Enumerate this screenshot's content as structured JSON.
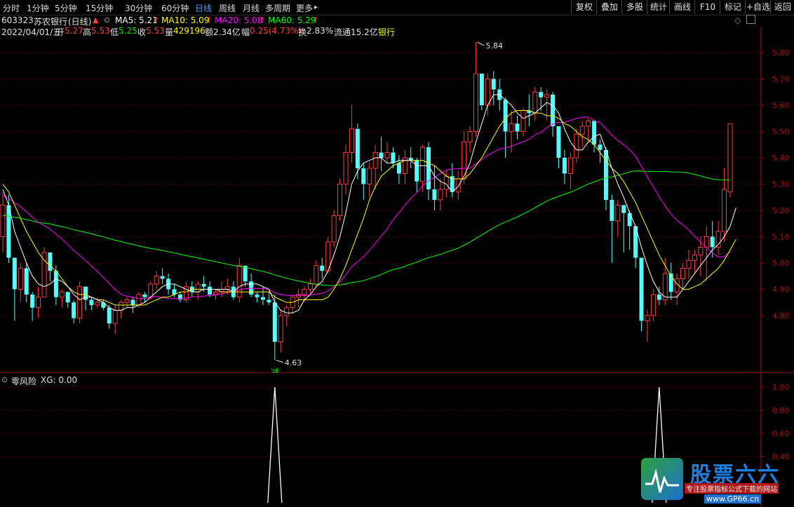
{
  "toolbar": {
    "periods": [
      "分时",
      "1分钟",
      "5分钟",
      "15分钟",
      "30分钟",
      "60分钟",
      "日线",
      "周线",
      "月线",
      "多周期",
      "更多"
    ],
    "active_period": "日线",
    "more_arrow": "▸",
    "buttons": [
      "复权",
      "叠加",
      "多股",
      "统计",
      "画线",
      "F10",
      "标记",
      "+自选",
      "返回"
    ]
  },
  "stock": {
    "code": "603323",
    "name": "苏农银行",
    "period_label": "(日线)",
    "ma5_label": "MA5: 5.21",
    "ma10_label": "MA10: 5.09",
    "ma20_label": "MA20: 5.08",
    "ma60_label": "MA60: 5.29",
    "up_arrow": "↑",
    "date": "2022/04/01/五",
    "open_label": "开",
    "open": "5.27",
    "high_label": "高",
    "high": "5.53",
    "low_label": "低",
    "low": "5.25",
    "close_label": "收",
    "close": "5.53",
    "volume_label": "量",
    "volume": "429196",
    "amount_label": "额",
    "amount": "2.34亿",
    "change_label": "幅",
    "change": "0.25(4.73%)",
    "turnover_label": "换",
    "turnover": "2.83%",
    "float_label": "流通",
    "float": "15.2亿",
    "industry": "银行"
  },
  "annotations": {
    "max_label": "5.84",
    "min_label": "4.63",
    "reduce_marker": "减"
  },
  "indicator": {
    "name": "零风险",
    "xg_label": "XG: 0.00"
  },
  "logo": {
    "title": "股票六六",
    "subtitle": "专注股票指标公式下载的网站",
    "url": "www.GP66.cn"
  },
  "colors": {
    "up": "#ff3c3c",
    "down": "#54fcfc",
    "ma5": "#ffffff",
    "ma10": "#ffff00",
    "ma20": "#ff00ff",
    "ma60": "#00ff00",
    "axis": "#b01010",
    "grid": "#5a0000"
  },
  "chart_data": [
    {
      "type": "candlestick",
      "ylim": [
        4.6,
        5.9
      ],
      "y_ticks": [
        "5.80",
        "5.70",
        "5.60",
        "5.50",
        "5.40",
        "5.30",
        "5.20",
        "5.10",
        "5.00",
        "4.90",
        "4.80"
      ],
      "series_ohlc": [
        [
          5.1,
          5.27,
          5.04,
          5.22
        ],
        [
          5.22,
          5.26,
          5.0,
          5.02
        ],
        [
          5.02,
          4.96,
          4.78,
          4.9
        ],
        [
          4.9,
          5.0,
          4.85,
          4.98
        ],
        [
          4.98,
          5.0,
          4.85,
          4.88
        ],
        [
          4.88,
          4.89,
          4.78,
          4.83
        ],
        [
          4.83,
          4.91,
          4.79,
          4.87
        ],
        [
          4.87,
          5.06,
          4.87,
          5.04
        ],
        [
          5.04,
          5.02,
          4.93,
          4.97
        ],
        [
          4.97,
          4.99,
          4.84,
          4.87
        ],
        [
          4.87,
          4.9,
          4.83,
          4.89
        ],
        [
          4.89,
          4.88,
          4.83,
          4.85
        ],
        [
          4.85,
          4.86,
          4.77,
          4.79
        ],
        [
          4.79,
          4.93,
          4.77,
          4.91
        ],
        [
          4.91,
          4.91,
          4.82,
          4.86
        ],
        [
          4.86,
          4.87,
          4.82,
          4.84
        ],
        [
          4.84,
          4.87,
          4.83,
          4.85
        ],
        [
          4.85,
          4.86,
          4.82,
          4.83
        ],
        [
          4.83,
          4.84,
          4.75,
          4.77
        ],
        [
          4.77,
          4.84,
          4.73,
          4.82
        ],
        [
          4.82,
          4.86,
          4.79,
          4.85
        ],
        [
          4.85,
          4.87,
          4.83,
          4.86
        ],
        [
          4.86,
          4.87,
          4.81,
          4.84
        ],
        [
          4.84,
          4.89,
          4.83,
          4.88
        ],
        [
          4.88,
          4.89,
          4.85,
          4.87
        ],
        [
          4.87,
          4.93,
          4.86,
          4.92
        ],
        [
          4.92,
          4.97,
          4.9,
          4.95
        ],
        [
          4.95,
          4.98,
          4.92,
          4.94
        ],
        [
          4.94,
          4.96,
          4.88,
          4.9
        ],
        [
          4.9,
          4.92,
          4.87,
          4.88
        ],
        [
          4.88,
          4.89,
          4.85,
          4.86
        ],
        [
          4.86,
          4.93,
          4.85,
          4.91
        ],
        [
          4.91,
          4.93,
          4.87,
          4.89
        ],
        [
          4.89,
          4.93,
          4.86,
          4.92
        ],
        [
          4.92,
          4.95,
          4.89,
          4.91
        ],
        [
          4.91,
          4.93,
          4.87,
          4.88
        ],
        [
          4.88,
          4.9,
          4.86,
          4.89
        ],
        [
          4.89,
          4.93,
          4.87,
          4.9
        ],
        [
          4.9,
          4.94,
          4.88,
          4.91
        ],
        [
          4.91,
          4.93,
          4.86,
          4.87
        ],
        [
          4.87,
          5.02,
          4.85,
          4.99
        ],
        [
          4.99,
          4.98,
          4.91,
          4.93
        ],
        [
          4.93,
          4.96,
          4.87,
          4.88
        ],
        [
          4.88,
          4.89,
          4.85,
          4.87
        ],
        [
          4.87,
          4.91,
          4.84,
          4.86
        ],
        [
          4.86,
          4.89,
          4.84,
          4.85
        ],
        [
          4.85,
          4.88,
          4.63,
          4.7
        ],
        [
          4.7,
          4.82,
          4.66,
          4.8
        ],
        [
          4.8,
          4.84,
          4.76,
          4.83
        ],
        [
          4.83,
          4.88,
          4.81,
          4.87
        ],
        [
          4.87,
          4.9,
          4.83,
          4.88
        ],
        [
          4.88,
          4.91,
          4.85,
          4.9
        ],
        [
          4.9,
          4.94,
          4.88,
          4.92
        ],
        [
          4.92,
          5.01,
          4.91,
          4.99
        ],
        [
          4.99,
          5.02,
          4.94,
          4.97
        ],
        [
          4.97,
          5.1,
          4.96,
          5.08
        ],
        [
          5.08,
          5.2,
          5.06,
          5.18
        ],
        [
          5.18,
          5.32,
          5.16,
          5.3
        ],
        [
          5.3,
          5.45,
          5.26,
          5.42
        ],
        [
          5.42,
          5.6,
          5.38,
          5.51
        ],
        [
          5.51,
          5.53,
          5.32,
          5.36
        ],
        [
          5.36,
          5.38,
          5.24,
          5.3
        ],
        [
          5.3,
          5.38,
          5.25,
          5.36
        ],
        [
          5.36,
          5.45,
          5.28,
          5.42
        ],
        [
          5.42,
          5.48,
          5.35,
          5.4
        ],
        [
          5.4,
          5.46,
          5.38,
          5.42
        ],
        [
          5.42,
          5.44,
          5.36,
          5.38
        ],
        [
          5.38,
          5.41,
          5.3,
          5.34
        ],
        [
          5.34,
          5.43,
          5.3,
          5.4
        ],
        [
          5.4,
          5.44,
          5.36,
          5.39
        ],
        [
          5.39,
          5.4,
          5.27,
          5.31
        ],
        [
          5.31,
          5.45,
          5.27,
          5.44
        ],
        [
          5.44,
          5.46,
          5.24,
          5.28
        ],
        [
          5.28,
          5.37,
          5.2,
          5.24
        ],
        [
          5.24,
          5.32,
          5.2,
          5.28
        ],
        [
          5.28,
          5.35,
          5.25,
          5.33
        ],
        [
          5.33,
          5.38,
          5.25,
          5.27
        ],
        [
          5.27,
          5.35,
          5.24,
          5.32
        ],
        [
          5.32,
          5.5,
          5.3,
          5.46
        ],
        [
          5.46,
          5.52,
          5.42,
          5.5
        ],
        [
          5.5,
          5.84,
          5.48,
          5.72
        ],
        [
          5.72,
          5.7,
          5.58,
          5.6
        ],
        [
          5.6,
          5.72,
          5.56,
          5.7
        ],
        [
          5.7,
          5.73,
          5.6,
          5.66
        ],
        [
          5.66,
          5.7,
          5.58,
          5.62
        ],
        [
          5.62,
          5.63,
          5.4,
          5.5
        ],
        [
          5.5,
          5.58,
          5.42,
          5.53
        ],
        [
          5.53,
          5.56,
          5.47,
          5.5
        ],
        [
          5.5,
          5.59,
          5.48,
          5.58
        ],
        [
          5.58,
          5.64,
          5.52,
          5.57
        ],
        [
          5.57,
          5.67,
          5.54,
          5.65
        ],
        [
          5.65,
          5.67,
          5.58,
          5.63
        ],
        [
          5.63,
          5.66,
          5.54,
          5.64
        ],
        [
          5.64,
          5.65,
          5.48,
          5.52
        ],
        [
          5.52,
          5.5,
          5.36,
          5.4
        ],
        [
          5.4,
          5.43,
          5.3,
          5.34
        ],
        [
          5.34,
          5.42,
          5.28,
          5.4
        ],
        [
          5.4,
          5.51,
          5.38,
          5.49
        ],
        [
          5.49,
          5.54,
          5.44,
          5.52
        ],
        [
          5.52,
          5.55,
          5.46,
          5.54
        ],
        [
          5.54,
          5.53,
          5.42,
          5.45
        ],
        [
          5.45,
          5.47,
          5.38,
          5.43
        ],
        [
          5.43,
          5.44,
          5.2,
          5.24
        ],
        [
          5.24,
          5.26,
          5.0,
          5.16
        ],
        [
          5.16,
          5.24,
          5.1,
          5.22
        ],
        [
          5.22,
          5.21,
          5.04,
          5.19
        ],
        [
          5.19,
          5.2,
          5.05,
          5.14
        ],
        [
          5.14,
          5.12,
          4.98,
          5.02
        ],
        [
          5.02,
          5.0,
          4.74,
          4.78
        ],
        [
          4.78,
          4.82,
          4.7,
          4.8
        ],
        [
          4.8,
          4.9,
          4.78,
          4.88
        ],
        [
          4.88,
          4.91,
          4.84,
          4.86
        ],
        [
          4.86,
          5.02,
          4.84,
          4.96
        ],
        [
          4.96,
          5.0,
          4.86,
          4.89
        ],
        [
          4.89,
          4.96,
          4.84,
          4.94
        ],
        [
          4.94,
          5.0,
          4.9,
          4.98
        ],
        [
          4.98,
          5.05,
          4.94,
          5.01
        ],
        [
          5.01,
          5.05,
          4.96,
          5.03
        ],
        [
          5.03,
          5.1,
          4.95,
          5.06
        ],
        [
          5.06,
          5.14,
          4.93,
          5.1
        ],
        [
          5.1,
          5.16,
          5.02,
          5.06
        ],
        [
          5.06,
          5.16,
          5.03,
          5.12
        ],
        [
          5.12,
          5.36,
          5.08,
          5.28
        ],
        [
          5.27,
          5.53,
          5.25,
          5.53
        ]
      ],
      "ma5": [
        5.28,
        5.22,
        5.12,
        5.06,
        5.0,
        4.95,
        4.92,
        4.91,
        4.92,
        4.94,
        4.93,
        4.91,
        4.88,
        4.86,
        4.87,
        4.87,
        4.86,
        4.85,
        4.83,
        4.82,
        4.82,
        4.83,
        4.83,
        4.84,
        4.85,
        4.87,
        4.89,
        4.91,
        4.92,
        4.92,
        4.91,
        4.9,
        4.89,
        4.89,
        4.9,
        4.9,
        4.9,
        4.9,
        4.9,
        4.89,
        4.91,
        4.92,
        4.92,
        4.92,
        4.91,
        4.9,
        4.85,
        4.82,
        4.81,
        4.81,
        4.82,
        4.86,
        4.88,
        4.91,
        4.93,
        4.97,
        5.03,
        5.1,
        5.19,
        5.3,
        5.35,
        5.38,
        5.39,
        5.4,
        5.4,
        5.38,
        5.38,
        5.39,
        5.39,
        5.39,
        5.37,
        5.37,
        5.37,
        5.33,
        5.31,
        5.3,
        5.27,
        5.29,
        5.33,
        5.38,
        5.46,
        5.53,
        5.6,
        5.64,
        5.64,
        5.62,
        5.6,
        5.57,
        5.55,
        5.56,
        5.57,
        5.59,
        5.61,
        5.6,
        5.57,
        5.51,
        5.46,
        5.43,
        5.43,
        5.46,
        5.48,
        5.49,
        5.43,
        5.36,
        5.3,
        5.25,
        5.19,
        5.14,
        5.06,
        4.99,
        4.93,
        4.89,
        4.87,
        4.87,
        4.87,
        4.9,
        4.93,
        4.96,
        4.99,
        5.02,
        5.05,
        5.07,
        5.1,
        5.14,
        5.21
      ],
      "ma10": [
        5.3,
        5.27,
        5.22,
        5.17,
        5.12,
        5.08,
        5.04,
        5.01,
        4.99,
        4.97,
        4.94,
        4.91,
        4.89,
        4.88,
        4.88,
        4.87,
        4.86,
        4.86,
        4.85,
        4.84,
        4.84,
        4.84,
        4.84,
        4.84,
        4.84,
        4.85,
        4.86,
        4.87,
        4.87,
        4.88,
        4.89,
        4.89,
        4.9,
        4.9,
        4.9,
        4.9,
        4.9,
        4.89,
        4.89,
        4.89,
        4.89,
        4.89,
        4.89,
        4.89,
        4.89,
        4.89,
        4.87,
        4.86,
        4.85,
        4.85,
        4.86,
        4.86,
        4.86,
        4.86,
        4.86,
        4.87,
        4.9,
        4.94,
        4.99,
        5.05,
        5.11,
        5.17,
        5.24,
        5.29,
        5.33,
        5.35,
        5.37,
        5.38,
        5.39,
        5.39,
        5.39,
        5.39,
        5.38,
        5.37,
        5.35,
        5.33,
        5.32,
        5.32,
        5.32,
        5.34,
        5.37,
        5.4,
        5.44,
        5.48,
        5.52,
        5.55,
        5.57,
        5.58,
        5.58,
        5.58,
        5.57,
        5.57,
        5.56,
        5.56,
        5.55,
        5.53,
        5.52,
        5.5,
        5.48,
        5.47,
        5.45,
        5.42,
        5.39,
        5.36,
        5.34,
        5.31,
        5.27,
        5.23,
        5.18,
        5.13,
        5.08,
        5.03,
        4.99,
        4.95,
        4.92,
        4.9,
        4.9,
        4.91,
        4.92,
        4.94,
        4.96,
        4.98,
        5.01,
        5.05,
        5.09
      ]
    },
    {
      "type": "line",
      "name": "XG",
      "ylim": [
        0,
        1.1
      ],
      "y_ticks": [
        "1.00",
        "0.80",
        "0.60",
        "0.40"
      ],
      "signal_candles": [
        46,
        111
      ],
      "values": "0 except 1.00 at candles 46 and 111"
    }
  ]
}
